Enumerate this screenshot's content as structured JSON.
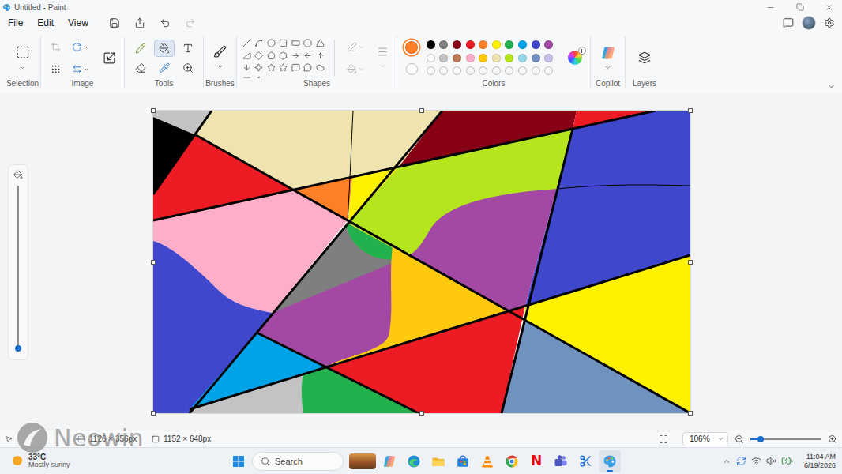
{
  "window": {
    "title": "Untitled - Paint"
  },
  "menu": [
    {
      "label": "File"
    },
    {
      "label": "Edit"
    },
    {
      "label": "View"
    }
  ],
  "quick_actions": [
    {
      "kind": "save",
      "disabled": false
    },
    {
      "kind": "share",
      "disabled": false
    },
    {
      "kind": "undo",
      "disabled": false
    },
    {
      "kind": "redo",
      "disabled": true
    }
  ],
  "ribbon": {
    "groups": [
      "Selection",
      "Image",
      "Tools",
      "Brushes",
      "Shapes",
      "Colors",
      "Copilot",
      "Layers"
    ],
    "tools": [
      {
        "kind": "pencil",
        "selected": false
      },
      {
        "kind": "fill",
        "selected": true
      },
      {
        "kind": "text",
        "selected": false
      },
      {
        "kind": "eraser",
        "selected": false
      },
      {
        "kind": "picker",
        "selected": false
      },
      {
        "kind": "magnifier",
        "selected": false
      }
    ],
    "shape_options": {
      "disabled": true
    },
    "colors": {
      "current": [
        {
          "color": "#ff7f27",
          "selected": true
        },
        {
          "color": "#ffffff",
          "selected": false
        }
      ],
      "palette": [
        {
          "color": "#000000"
        },
        {
          "color": "#7f7f7f"
        },
        {
          "color": "#880015"
        },
        {
          "color": "#ed1c24"
        },
        {
          "color": "#ff7f27"
        },
        {
          "color": "#fff200"
        },
        {
          "color": "#22b14c"
        },
        {
          "color": "#00a2e8"
        },
        {
          "color": "#3f48cc"
        },
        {
          "color": "#a349a4"
        },
        {
          "color": "#ffffff"
        },
        {
          "color": "#c3c3c3"
        },
        {
          "color": "#b97a57"
        },
        {
          "color": "#ffaec9"
        },
        {
          "color": "#ffc90e"
        },
        {
          "color": "#efe4b0"
        },
        {
          "color": "#b5e61d"
        },
        {
          "color": "#99d9ea"
        },
        {
          "color": "#7092be"
        },
        {
          "color": "#c8bfe7"
        }
      ]
    }
  },
  "brush_size": {
    "level": 0
  },
  "status_bar": {
    "selection_size": "1126 × 356px",
    "canvas_size": "1152 × 648px",
    "zoom": "106%",
    "zoom_level": 0.14
  },
  "taskbar": {
    "weather": {
      "temperature": "33°C",
      "condition": "Mostly sunny"
    },
    "search": {
      "placeholder": "Search"
    },
    "apps": [
      {
        "kind": "copilot",
        "active": false
      },
      {
        "kind": "edge",
        "active": false
      },
      {
        "kind": "explorer",
        "active": false
      },
      {
        "kind": "store",
        "active": false
      },
      {
        "kind": "vlc",
        "active": false
      },
      {
        "kind": "chrome",
        "active": false
      },
      {
        "kind": "netflix",
        "text": "N",
        "active": false
      },
      {
        "kind": "teams",
        "active": false
      },
      {
        "kind": "snipping",
        "active": false
      },
      {
        "kind": "paint",
        "active": true
      }
    ],
    "clock": {
      "time": "11:04 AM",
      "date": "6/19/2026"
    }
  },
  "watermark": "Neowin"
}
